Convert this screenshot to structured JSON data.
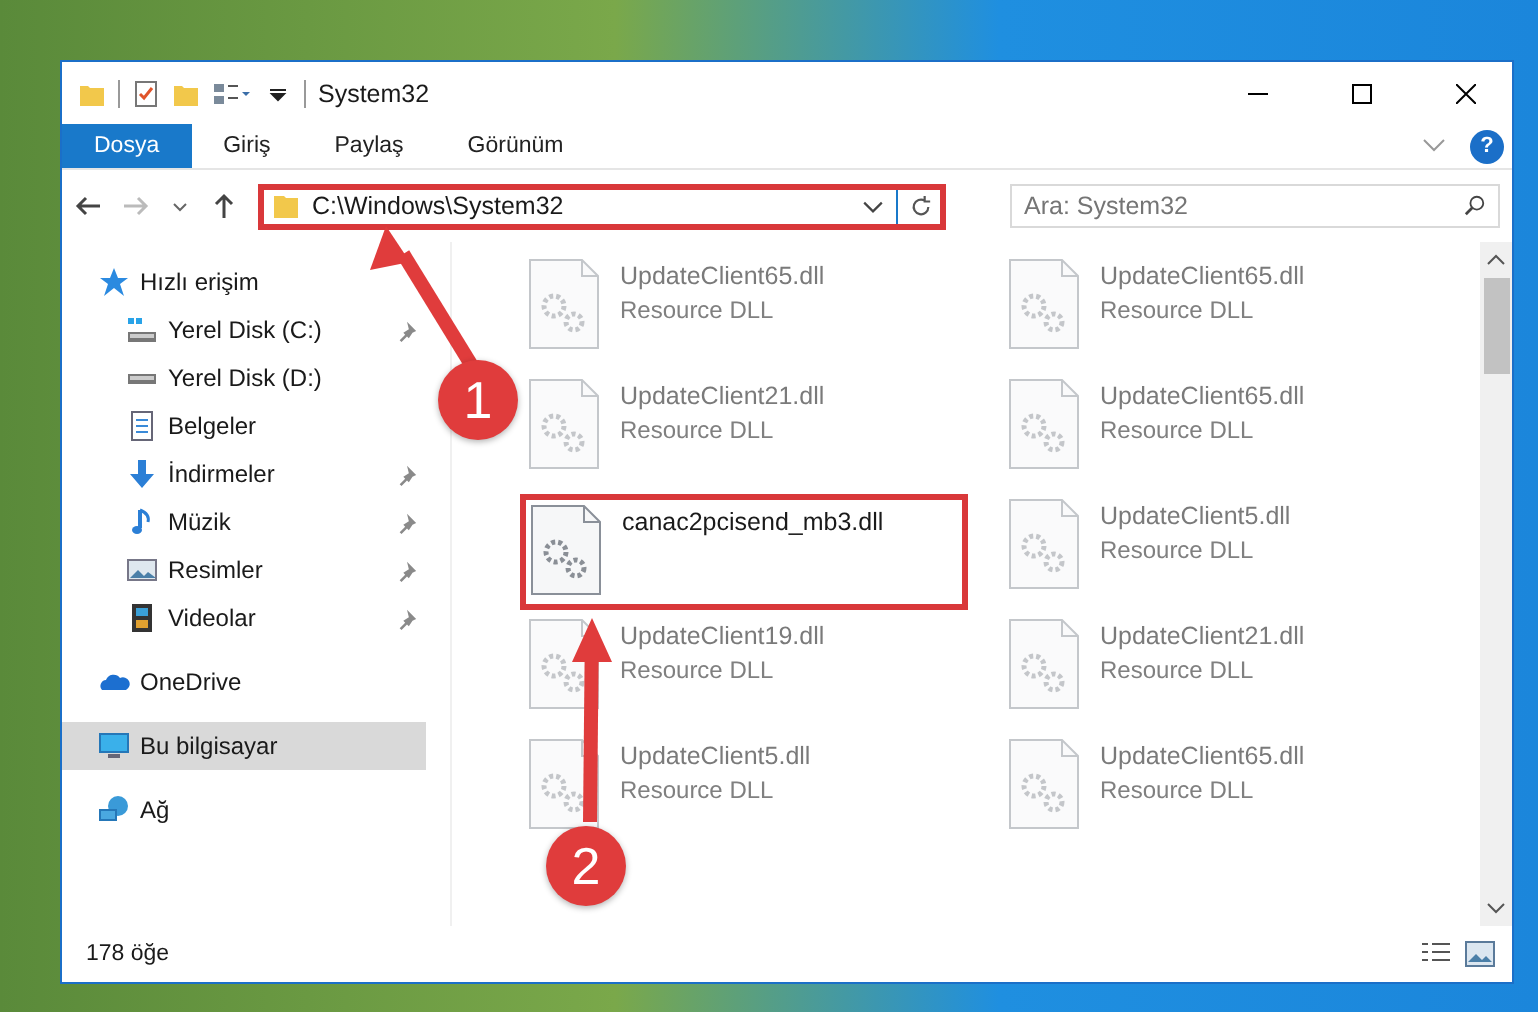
{
  "window": {
    "title": "System32"
  },
  "ribbon_tabs": [
    {
      "label": "Dosya",
      "selected": true
    },
    {
      "label": "Giriş",
      "selected": false
    },
    {
      "label": "Paylaş",
      "selected": false
    },
    {
      "label": "Görünüm",
      "selected": false
    }
  ],
  "address": {
    "path": "C:\\Windows\\System32",
    "highlighted": true
  },
  "search": {
    "placeholder": "Ara: System32"
  },
  "help_button": {
    "glyph": "?"
  },
  "sidebar": {
    "items": [
      {
        "label": "Hızlı erişim",
        "kind": "star",
        "selected": false,
        "children": [
          {
            "label": "Yerel Disk (C:)",
            "kind": "windrive",
            "pinned": true,
            "selected": false
          },
          {
            "label": "Yerel Disk (D:)",
            "kind": "drive",
            "pinned": false,
            "selected": false
          },
          {
            "label": "Belgeler",
            "kind": "docs",
            "pinned": false,
            "selected": false
          },
          {
            "label": "İndirmeler",
            "kind": "download",
            "pinned": true,
            "selected": false
          },
          {
            "label": "Müzik",
            "kind": "music",
            "pinned": true,
            "selected": false
          },
          {
            "label": "Resimler",
            "kind": "pictures",
            "pinned": true,
            "selected": false
          },
          {
            "label": "Videolar",
            "kind": "video",
            "pinned": true,
            "selected": false
          }
        ]
      },
      {
        "label": "OneDrive",
        "kind": "cloud",
        "selected": false
      },
      {
        "label": "Bu bilgisayar",
        "kind": "computer",
        "selected": true
      },
      {
        "label": "Ağ",
        "kind": "network",
        "selected": false
      }
    ]
  },
  "files": [
    {
      "name": "UpdateClient65.dll",
      "type": "Resource DLL",
      "blurred": true,
      "highlighted": false
    },
    {
      "name": "UpdateClient65.dll",
      "type": "Resource DLL",
      "blurred": true,
      "highlighted": false
    },
    {
      "name": "UpdateClient21.dll",
      "type": "Resource DLL",
      "blurred": true,
      "highlighted": false
    },
    {
      "name": "UpdateClient65.dll",
      "type": "Resource DLL",
      "blurred": true,
      "highlighted": false
    },
    {
      "name": "canac2pcisend_mb3.dll",
      "blurred": false,
      "highlighted": true
    },
    {
      "name": "UpdateClient5.dll",
      "type": "Resource DLL",
      "blurred": true,
      "highlighted": false
    },
    {
      "name": "UpdateClient19.dll",
      "type": "Resource DLL",
      "blurred": true,
      "highlighted": false
    },
    {
      "name": "UpdateClient21.dll",
      "type": "Resource DLL",
      "blurred": true,
      "highlighted": false
    },
    {
      "name": "UpdateClient5.dll",
      "type": "Resource DLL",
      "blurred": true,
      "highlighted": false
    },
    {
      "name": "UpdateClient65.dll",
      "type": "Resource DLL",
      "blurred": true,
      "highlighted": false
    }
  ],
  "status_bar": {
    "item_count": "178 öğe"
  },
  "callouts": [
    {
      "number": "1"
    },
    {
      "number": "2"
    }
  ]
}
